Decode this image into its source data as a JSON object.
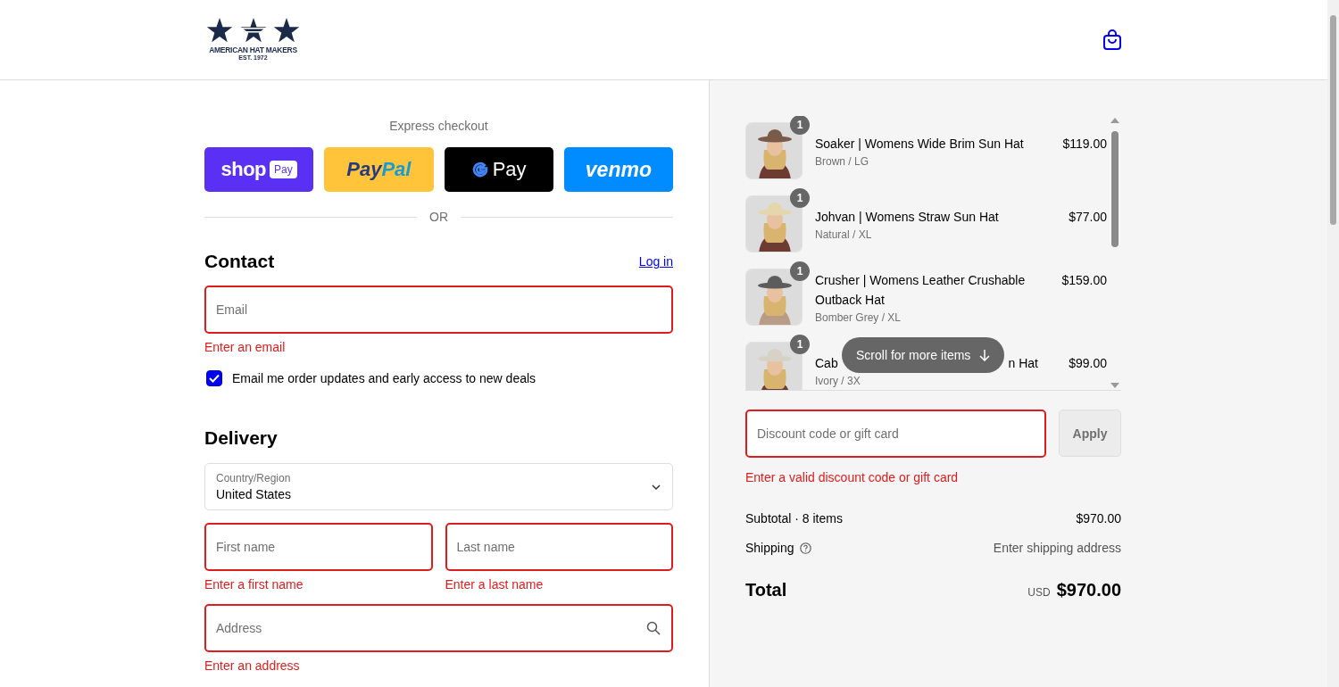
{
  "header": {
    "logo": {
      "name": "AMERICAN HAT MAKERS",
      "est": "EST. 1972"
    }
  },
  "express_checkout": {
    "label": "Express checkout",
    "buttons": [
      {
        "kind": "shop",
        "text": "shop",
        "badge": "Pay"
      },
      {
        "kind": "paypal",
        "text": "Pay",
        "text2": "Pal"
      },
      {
        "kind": "gpay",
        "text": "Pay"
      },
      {
        "kind": "venmo",
        "text": "venmo"
      }
    ],
    "divider": "OR"
  },
  "contact": {
    "heading": "Contact",
    "login": "Log in",
    "email": {
      "placeholder": "Email",
      "invalid": true,
      "error": "Enter an email"
    },
    "newsletter": {
      "label": "Email me order updates and early access to new deals",
      "checked": true
    }
  },
  "delivery": {
    "heading": "Delivery",
    "country": {
      "label": "Country/Region",
      "value": "United States"
    },
    "first_name": {
      "placeholder": "First name",
      "invalid": true,
      "error": "Enter a first name"
    },
    "last_name": {
      "placeholder": "Last name",
      "invalid": true,
      "error": "Enter a last name"
    },
    "address": {
      "placeholder": "Address",
      "invalid": true,
      "error": "Enter an address"
    }
  },
  "order": {
    "items": [
      {
        "quantity": "1",
        "title": "Soaker | Womens Wide Brim Sun Hat",
        "variant": "Brown / LG",
        "price": "$119.00"
      },
      {
        "quantity": "1",
        "title": "Johvan | Womens Straw Sun Hat",
        "variant": "Natural / XL",
        "price": "$77.00"
      },
      {
        "quantity": "1",
        "title": "Crusher | Womens Leather Crushable Outback Hat",
        "variant": "Bomber Grey / XL",
        "price": "$159.00"
      },
      {
        "quantity": "1",
        "title": "Cab",
        "title_end": "n Hat",
        "variant": "Ivory / 3X",
        "price": "$99.00"
      }
    ],
    "scroll_hint": "Scroll for more items",
    "discount": {
      "placeholder": "Discount code or gift card",
      "invalid": true,
      "error": "Enter a valid discount code or gift card",
      "button": "Apply",
      "disabled": true
    },
    "subtotal": {
      "label": "Subtotal · 8 items",
      "value": "$970.00"
    },
    "shipping": {
      "label": "Shipping",
      "value": "Enter shipping address"
    },
    "total": {
      "label": "Total",
      "currency": "USD",
      "value": "$970.00"
    }
  }
}
